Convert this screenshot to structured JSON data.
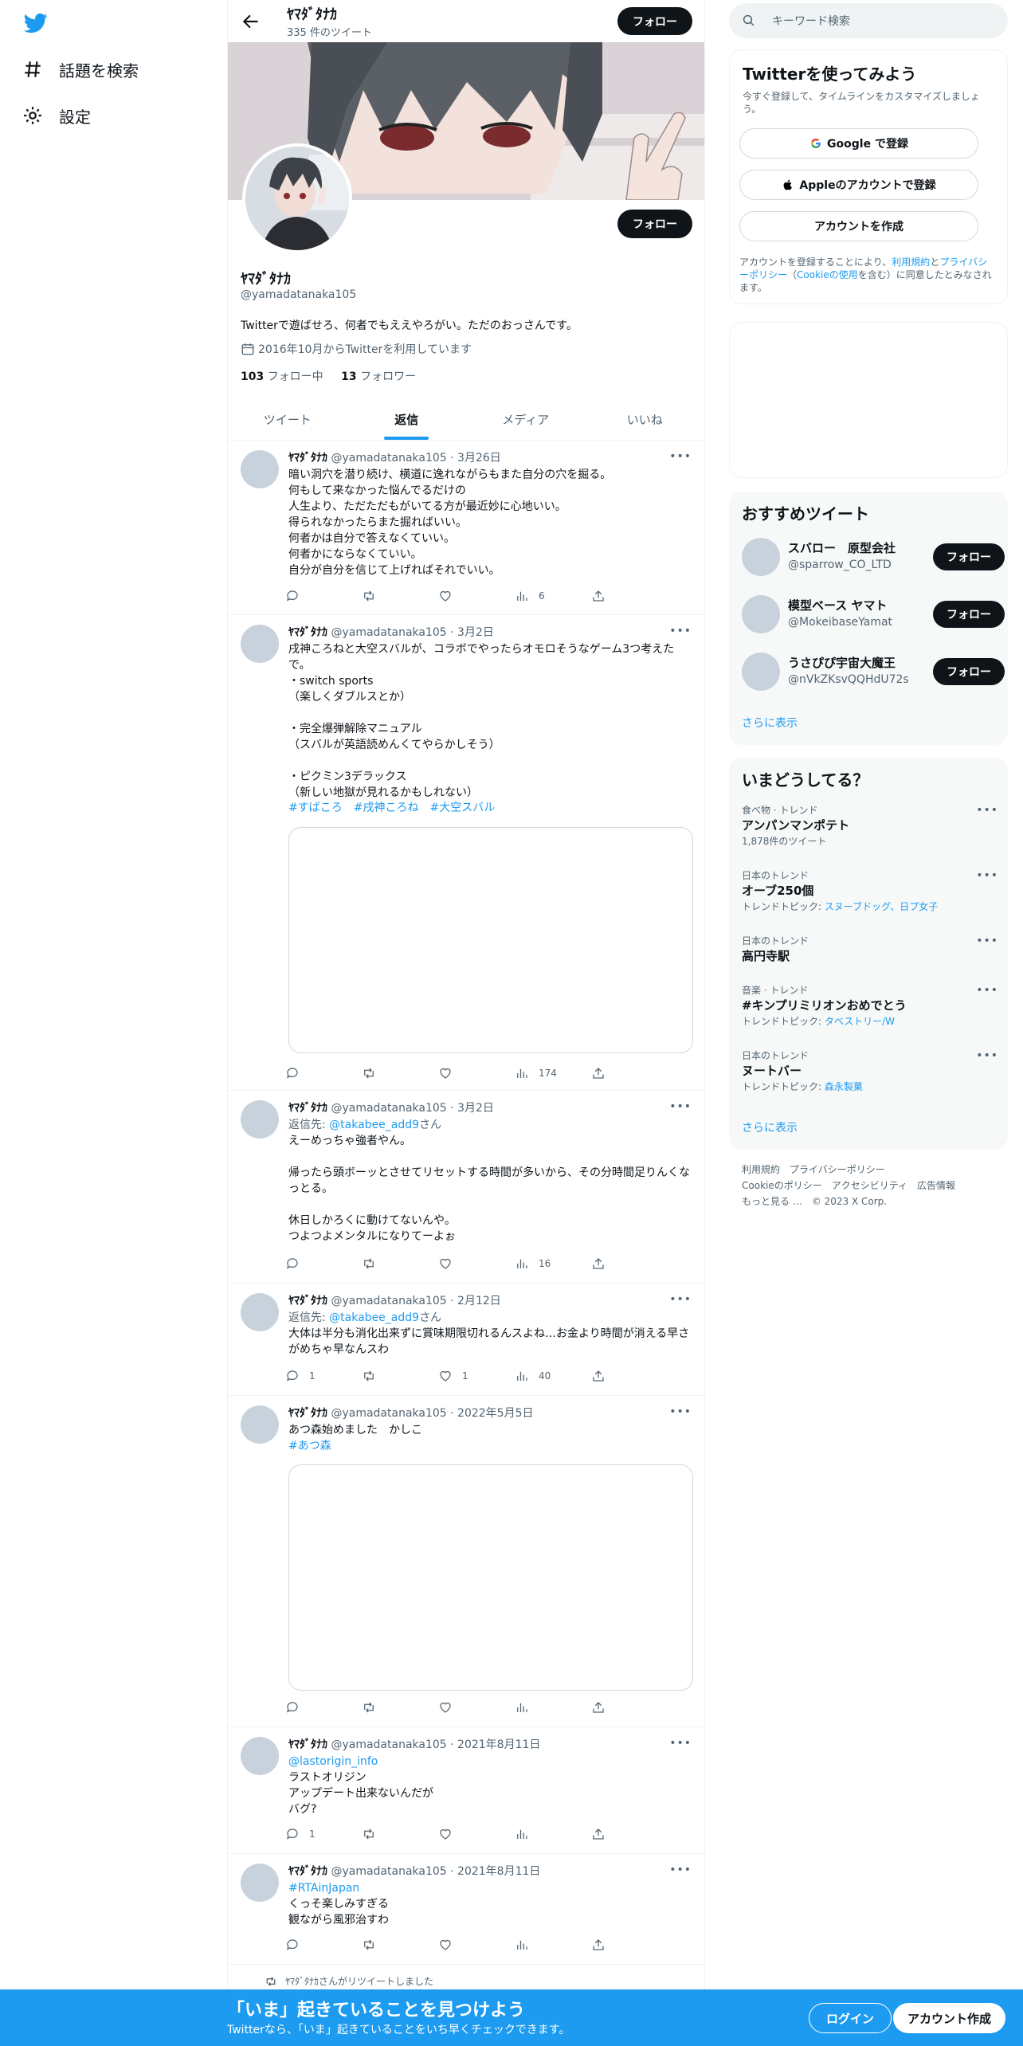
{
  "left_nav": {
    "explore_label": "話題を検索",
    "settings_label": "設定"
  },
  "header": {
    "name": "ﾔﾏﾀﾞﾀﾅｶ",
    "tweet_count": "335 件のツイート",
    "follow_label": "フォロー"
  },
  "profile": {
    "follow_label": "フォロー",
    "name": "ﾔﾏﾀﾞﾀﾅｶ",
    "handle": "@yamadatanaka105",
    "bio": "Twitterで遊ばせろ、何者でもええやろがい。ただのおっさんです。",
    "joined": "2016年10月からTwitterを利用しています",
    "following_count": "103",
    "following_label": "フォロー中",
    "followers_count": "13",
    "followers_label": "フォロワー"
  },
  "tabs": [
    "ツイート",
    "返信",
    "メディア",
    "いいね"
  ],
  "tweets": [
    {
      "name": "ﾔﾏﾀﾞﾀﾅｶ",
      "handle": "@yamadatanaka105 · 3月26日",
      "text": "暗い洞穴を潜り続け、横道に逸れながらもまた自分の穴を掘る。\n何もして来なかった悩んでるだけの\n人生より、ただただもがいてる方が最近妙に心地いい。\n得られなかったらまた掘ればいい。\n何者かは自分で答えなくていい。\n何者かにならなくていい。\n自分が自分を信じて上げればそれでいい。",
      "views": "6"
    },
    {
      "name": "ﾔﾏﾀﾞﾀﾅｶ",
      "handle": "@yamadatanaka105 · 3月2日",
      "text": "戌神ころねと大空スバルが、コラボでやったらオモロそうなゲーム3つ考えたで。\n・switch sports\n（楽しくダブルスとか）\n\n・完全爆弾解除マニュアル\n（スバルが英語読めんくてやらかしそう）\n\n・ピクミン3デラックス\n（新しい地獄が見れるかもしれない）",
      "hashtags": "#すばころ　#戌神ころね　#大空スバル",
      "views": "174"
    },
    {
      "name": "ﾔﾏﾀﾞﾀﾅｶ",
      "handle": "@yamadatanaka105 · 3月2日",
      "reply_prefix": "返信先: ",
      "reply_to": "@takabee_add9",
      "reply_suffix": "さん",
      "text": "えーめっちゃ強者やん。\n\n帰ったら頭ボーッとさせてリセットする時間が多いから、その分時間足りんくなっとる。\n\n休日しかろくに動けてないんや。\nつよつよメンタルになりてーよぉ",
      "views": "16"
    },
    {
      "name": "ﾔﾏﾀﾞﾀﾅｶ",
      "handle": "@yamadatanaka105 · 2月12日",
      "reply_prefix": "返信先: ",
      "reply_to": "@takabee_add9",
      "reply_suffix": "さん",
      "text": "大体は半分も消化出来ずに賞味期限切れるんスよね…お金より時間が消える早さがめちゃ早なんスわ",
      "replies": "1",
      "likes": "1",
      "views": "40"
    },
    {
      "name": "ﾔﾏﾀﾞﾀﾅｶ",
      "handle": "@yamadatanaka105 · 2022年5月5日",
      "text": "あつ森始めました　かしこ",
      "hashtags": "#あつ森"
    },
    {
      "name": "ﾔﾏﾀﾞﾀﾅｶ",
      "handle": "@yamadatanaka105 · 2021年8月11日",
      "mention": "@lastorigin_info",
      "text": "ラストオリジン\nアップデート出来ないんだが\nバグ?",
      "replies": "1"
    },
    {
      "name": "ﾔﾏﾀﾞﾀﾅｶ",
      "handle": "@yamadatanaka105 · 2021年8月11日",
      "hashtags": "#RTAinJapan",
      "text": "くっそ楽しみすぎる\n観ながら風邪治すわ"
    }
  ],
  "retweet_note": "ﾔﾏﾀﾞﾀﾅｶさんがリツイートしました",
  "right": {
    "search_placeholder": "キーワード検索",
    "signup_card": {
      "title": "Twitterを使ってみよう",
      "subtitle": "今すぐ登録して、タイムラインをカスタマイズしましょう。",
      "google": "Google で登録",
      "apple": "Appleのアカウントで登録",
      "create": "アカウントを作成",
      "legal_1": "アカウントを登録することにより、",
      "legal_terms": "利用規約",
      "legal_2": "と",
      "legal_privacy": "プライバシーポリシー",
      "legal_3": "（",
      "legal_cookie": "Cookieの使用",
      "legal_4": "を含む）に同意したとみなされます。"
    },
    "recommended": {
      "title": "おすすめツイート",
      "follow_label": "フォロー",
      "accounts": [
        {
          "name": "スバロー　原型会社",
          "handle": "@sparrow_CO_LTD"
        },
        {
          "name": "模型ベース ヤマト",
          "handle": "@MokeibaseYamat"
        },
        {
          "name": "うさぴぴ宇宙大魔王",
          "handle": "@nVkZKsvQQHdU72s"
        }
      ],
      "more": "さらに表示"
    },
    "trends": {
      "title": "いまどうしてる？",
      "items": [
        {
          "category": "食べ物 · トレンド",
          "name": "アンパンマンポテト",
          "sub": "1,878件のツイート"
        },
        {
          "category": "日本のトレンド",
          "name": "オーブ250個",
          "sub_prefix": "トレンドトピック: ",
          "sub_link": "スヌーブドッグ、日プ女子"
        },
        {
          "category": "日本のトレンド",
          "name": "高円寺駅"
        },
        {
          "category": "音楽 · トレンド",
          "name": "#キンプリミリオンおめでとう",
          "sub_prefix": "トレンドトピック: ",
          "sub_link": "タベストリー/W"
        },
        {
          "category": "日本のトレンド",
          "name": "ヌートバー",
          "sub_prefix": "トレンドトピック: ",
          "sub_link": "森永製菓"
        }
      ],
      "more": "さらに表示"
    },
    "footer": {
      "line1": "利用規約　プライバシーポリシー",
      "line2": "Cookieのポリシー　アクセシビリティ　広告情報",
      "line3": "もっと見る …　© 2023 X Corp."
    }
  },
  "bottom_bar": {
    "title": "「いま」起きていることを見つけよう",
    "subtitle": "Twitterなら、「いま」起きていることをいち早くチェックできます。",
    "login": "ログイン",
    "signup": "アカウント作成"
  },
  "colors": {
    "accent": "#1d9bf0",
    "text": "#0f1419",
    "secondary": "#536471"
  }
}
